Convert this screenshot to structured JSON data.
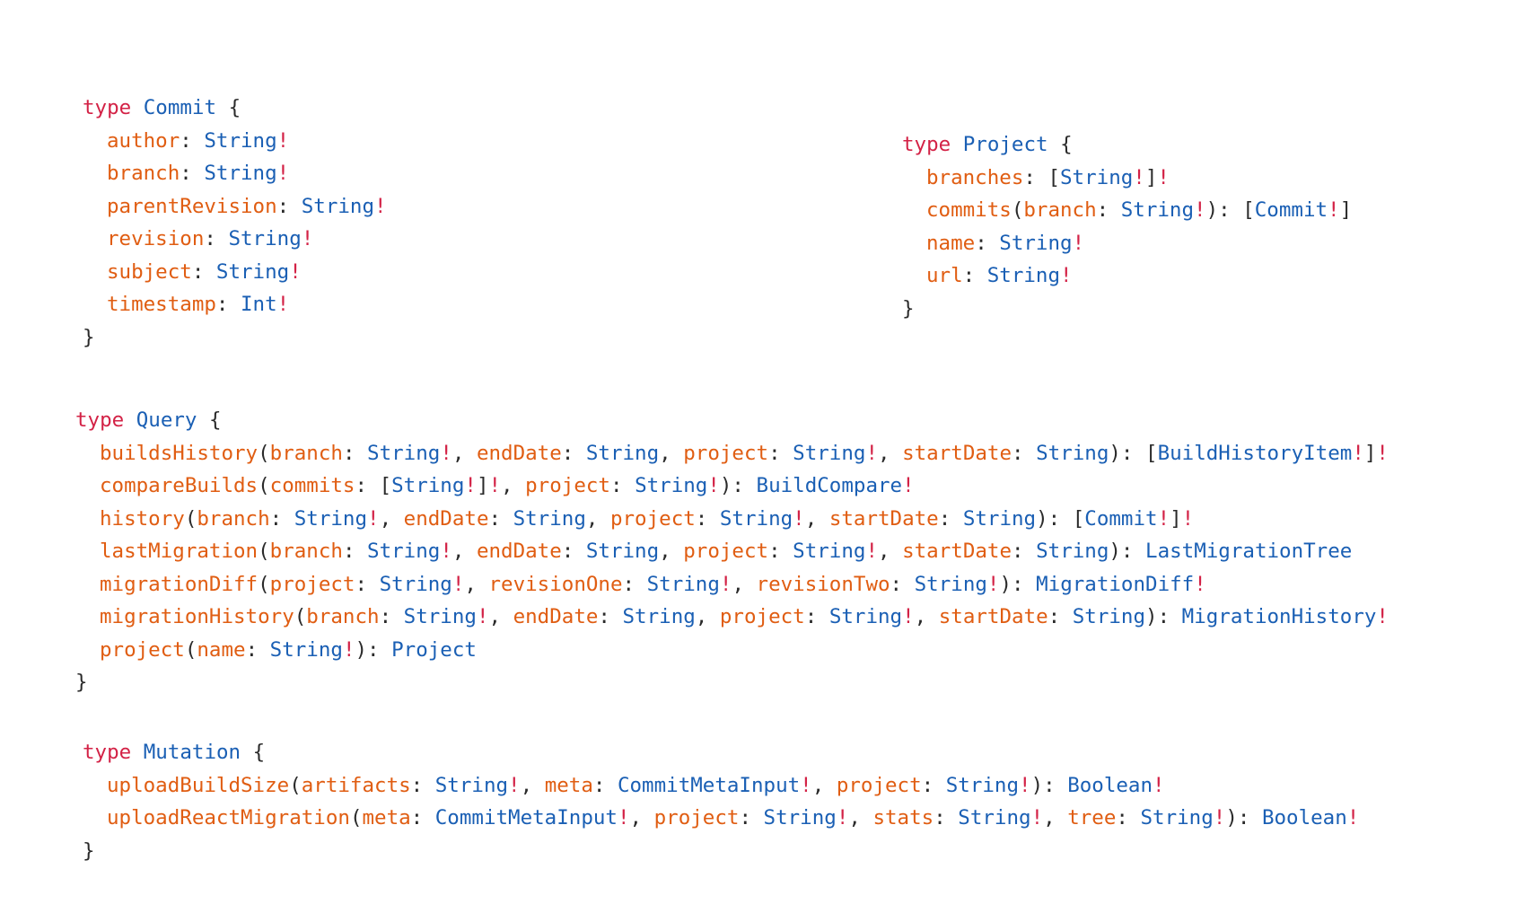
{
  "blocks": [
    {
      "id": "commit",
      "keyword": "type",
      "name": "Commit",
      "lines": [
        [
          [
            "fld",
            "author"
          ],
          [
            "pn",
            ": "
          ],
          [
            "tn",
            "String"
          ],
          [
            "bang",
            "!"
          ]
        ],
        [
          [
            "fld",
            "branch"
          ],
          [
            "pn",
            ": "
          ],
          [
            "tn",
            "String"
          ],
          [
            "bang",
            "!"
          ]
        ],
        [
          [
            "fld",
            "parentRevision"
          ],
          [
            "pn",
            ": "
          ],
          [
            "tn",
            "String"
          ],
          [
            "bang",
            "!"
          ]
        ],
        [
          [
            "fld",
            "revision"
          ],
          [
            "pn",
            ": "
          ],
          [
            "tn",
            "String"
          ],
          [
            "bang",
            "!"
          ]
        ],
        [
          [
            "fld",
            "subject"
          ],
          [
            "pn",
            ": "
          ],
          [
            "tn",
            "String"
          ],
          [
            "bang",
            "!"
          ]
        ],
        [
          [
            "fld",
            "timestamp"
          ],
          [
            "pn",
            ": "
          ],
          [
            "tn",
            "Int"
          ],
          [
            "bang",
            "!"
          ]
        ]
      ]
    },
    {
      "id": "project",
      "keyword": "type",
      "name": "Project",
      "lines": [
        [
          [
            "fld",
            "branches"
          ],
          [
            "pn",
            ": ["
          ],
          [
            "tn",
            "String"
          ],
          [
            "bang",
            "!"
          ],
          [
            "pn",
            "]"
          ],
          [
            "bang",
            "!"
          ]
        ],
        [
          [
            "fld",
            "commits"
          ],
          [
            "pn",
            "("
          ],
          [
            "fld",
            "branch"
          ],
          [
            "pn",
            ": "
          ],
          [
            "tn",
            "String"
          ],
          [
            "bang",
            "!"
          ],
          [
            "pn",
            "): ["
          ],
          [
            "tn",
            "Commit"
          ],
          [
            "bang",
            "!"
          ],
          [
            "pn",
            "]"
          ]
        ],
        [
          [
            "fld",
            "name"
          ],
          [
            "pn",
            ": "
          ],
          [
            "tn",
            "String"
          ],
          [
            "bang",
            "!"
          ]
        ],
        [
          [
            "fld",
            "url"
          ],
          [
            "pn",
            ": "
          ],
          [
            "tn",
            "String"
          ],
          [
            "bang",
            "!"
          ]
        ]
      ]
    },
    {
      "id": "query",
      "keyword": "type",
      "name": "Query",
      "lines": [
        [
          [
            "fld",
            "buildsHistory"
          ],
          [
            "pn",
            "("
          ],
          [
            "fld",
            "branch"
          ],
          [
            "pn",
            ": "
          ],
          [
            "tn",
            "String"
          ],
          [
            "bang",
            "!"
          ],
          [
            "pn",
            ", "
          ],
          [
            "fld",
            "endDate"
          ],
          [
            "pn",
            ": "
          ],
          [
            "tn",
            "String"
          ],
          [
            "pn",
            ", "
          ],
          [
            "fld",
            "project"
          ],
          [
            "pn",
            ": "
          ],
          [
            "tn",
            "String"
          ],
          [
            "bang",
            "!"
          ],
          [
            "pn",
            ", "
          ],
          [
            "fld",
            "startDate"
          ],
          [
            "pn",
            ": "
          ],
          [
            "tn",
            "String"
          ],
          [
            "pn",
            "): ["
          ],
          [
            "tn",
            "BuildHistoryItem"
          ],
          [
            "bang",
            "!"
          ],
          [
            "pn",
            "]"
          ],
          [
            "bang",
            "!"
          ]
        ],
        [
          [
            "fld",
            "compareBuilds"
          ],
          [
            "pn",
            "("
          ],
          [
            "fld",
            "commits"
          ],
          [
            "pn",
            ": ["
          ],
          [
            "tn",
            "String"
          ],
          [
            "bang",
            "!"
          ],
          [
            "pn",
            "]"
          ],
          [
            "bang",
            "!"
          ],
          [
            "pn",
            ", "
          ],
          [
            "fld",
            "project"
          ],
          [
            "pn",
            ": "
          ],
          [
            "tn",
            "String"
          ],
          [
            "bang",
            "!"
          ],
          [
            "pn",
            "): "
          ],
          [
            "tn",
            "BuildCompare"
          ],
          [
            "bang",
            "!"
          ]
        ],
        [
          [
            "fld",
            "history"
          ],
          [
            "pn",
            "("
          ],
          [
            "fld",
            "branch"
          ],
          [
            "pn",
            ": "
          ],
          [
            "tn",
            "String"
          ],
          [
            "bang",
            "!"
          ],
          [
            "pn",
            ", "
          ],
          [
            "fld",
            "endDate"
          ],
          [
            "pn",
            ": "
          ],
          [
            "tn",
            "String"
          ],
          [
            "pn",
            ", "
          ],
          [
            "fld",
            "project"
          ],
          [
            "pn",
            ": "
          ],
          [
            "tn",
            "String"
          ],
          [
            "bang",
            "!"
          ],
          [
            "pn",
            ", "
          ],
          [
            "fld",
            "startDate"
          ],
          [
            "pn",
            ": "
          ],
          [
            "tn",
            "String"
          ],
          [
            "pn",
            "): ["
          ],
          [
            "tn",
            "Commit"
          ],
          [
            "bang",
            "!"
          ],
          [
            "pn",
            "]"
          ],
          [
            "bang",
            "!"
          ]
        ],
        [
          [
            "fld",
            "lastMigration"
          ],
          [
            "pn",
            "("
          ],
          [
            "fld",
            "branch"
          ],
          [
            "pn",
            ": "
          ],
          [
            "tn",
            "String"
          ],
          [
            "bang",
            "!"
          ],
          [
            "pn",
            ", "
          ],
          [
            "fld",
            "endDate"
          ],
          [
            "pn",
            ": "
          ],
          [
            "tn",
            "String"
          ],
          [
            "pn",
            ", "
          ],
          [
            "fld",
            "project"
          ],
          [
            "pn",
            ": "
          ],
          [
            "tn",
            "String"
          ],
          [
            "bang",
            "!"
          ],
          [
            "pn",
            ", "
          ],
          [
            "fld",
            "startDate"
          ],
          [
            "pn",
            ": "
          ],
          [
            "tn",
            "String"
          ],
          [
            "pn",
            "): "
          ],
          [
            "tn",
            "LastMigrationTree"
          ]
        ],
        [
          [
            "fld",
            "migrationDiff"
          ],
          [
            "pn",
            "("
          ],
          [
            "fld",
            "project"
          ],
          [
            "pn",
            ": "
          ],
          [
            "tn",
            "String"
          ],
          [
            "bang",
            "!"
          ],
          [
            "pn",
            ", "
          ],
          [
            "fld",
            "revisionOne"
          ],
          [
            "pn",
            ": "
          ],
          [
            "tn",
            "String"
          ],
          [
            "bang",
            "!"
          ],
          [
            "pn",
            ", "
          ],
          [
            "fld",
            "revisionTwo"
          ],
          [
            "pn",
            ": "
          ],
          [
            "tn",
            "String"
          ],
          [
            "bang",
            "!"
          ],
          [
            "pn",
            "): "
          ],
          [
            "tn",
            "MigrationDiff"
          ],
          [
            "bang",
            "!"
          ]
        ],
        [
          [
            "fld",
            "migrationHistory"
          ],
          [
            "pn",
            "("
          ],
          [
            "fld",
            "branch"
          ],
          [
            "pn",
            ": "
          ],
          [
            "tn",
            "String"
          ],
          [
            "bang",
            "!"
          ],
          [
            "pn",
            ", "
          ],
          [
            "fld",
            "endDate"
          ],
          [
            "pn",
            ": "
          ],
          [
            "tn",
            "String"
          ],
          [
            "pn",
            ", "
          ],
          [
            "fld",
            "project"
          ],
          [
            "pn",
            ": "
          ],
          [
            "tn",
            "String"
          ],
          [
            "bang",
            "!"
          ],
          [
            "pn",
            ", "
          ],
          [
            "fld",
            "startDate"
          ],
          [
            "pn",
            ": "
          ],
          [
            "tn",
            "String"
          ],
          [
            "pn",
            "): "
          ],
          [
            "tn",
            "MigrationHistory"
          ],
          [
            "bang",
            "!"
          ]
        ],
        [
          [
            "fld",
            "project"
          ],
          [
            "pn",
            "("
          ],
          [
            "fld",
            "name"
          ],
          [
            "pn",
            ": "
          ],
          [
            "tn",
            "String"
          ],
          [
            "bang",
            "!"
          ],
          [
            "pn",
            "): "
          ],
          [
            "tn",
            "Project"
          ]
        ]
      ]
    },
    {
      "id": "mutation",
      "keyword": "type",
      "name": "Mutation",
      "lines": [
        [
          [
            "fld",
            "uploadBuildSize"
          ],
          [
            "pn",
            "("
          ],
          [
            "fld",
            "artifacts"
          ],
          [
            "pn",
            ": "
          ],
          [
            "tn",
            "String"
          ],
          [
            "bang",
            "!"
          ],
          [
            "pn",
            ", "
          ],
          [
            "fld",
            "meta"
          ],
          [
            "pn",
            ": "
          ],
          [
            "tn",
            "CommitMetaInput"
          ],
          [
            "bang",
            "!"
          ],
          [
            "pn",
            ", "
          ],
          [
            "fld",
            "project"
          ],
          [
            "pn",
            ": "
          ],
          [
            "tn",
            "String"
          ],
          [
            "bang",
            "!"
          ],
          [
            "pn",
            "): "
          ],
          [
            "tn",
            "Boolean"
          ],
          [
            "bang",
            "!"
          ]
        ],
        [
          [
            "fld",
            "uploadReactMigration"
          ],
          [
            "pn",
            "("
          ],
          [
            "fld",
            "meta"
          ],
          [
            "pn",
            ": "
          ],
          [
            "tn",
            "CommitMetaInput"
          ],
          [
            "bang",
            "!"
          ],
          [
            "pn",
            ", "
          ],
          [
            "fld",
            "project"
          ],
          [
            "pn",
            ": "
          ],
          [
            "tn",
            "String"
          ],
          [
            "bang",
            "!"
          ],
          [
            "pn",
            ", "
          ],
          [
            "fld",
            "stats"
          ],
          [
            "pn",
            ": "
          ],
          [
            "tn",
            "String"
          ],
          [
            "bang",
            "!"
          ],
          [
            "pn",
            ", "
          ],
          [
            "fld",
            "tree"
          ],
          [
            "pn",
            ": "
          ],
          [
            "tn",
            "String"
          ],
          [
            "bang",
            "!"
          ],
          [
            "pn",
            "): "
          ],
          [
            "tn",
            "Boolean"
          ],
          [
            "bang",
            "!"
          ]
        ]
      ]
    }
  ],
  "punct": {
    "open": "{",
    "close": "}"
  }
}
